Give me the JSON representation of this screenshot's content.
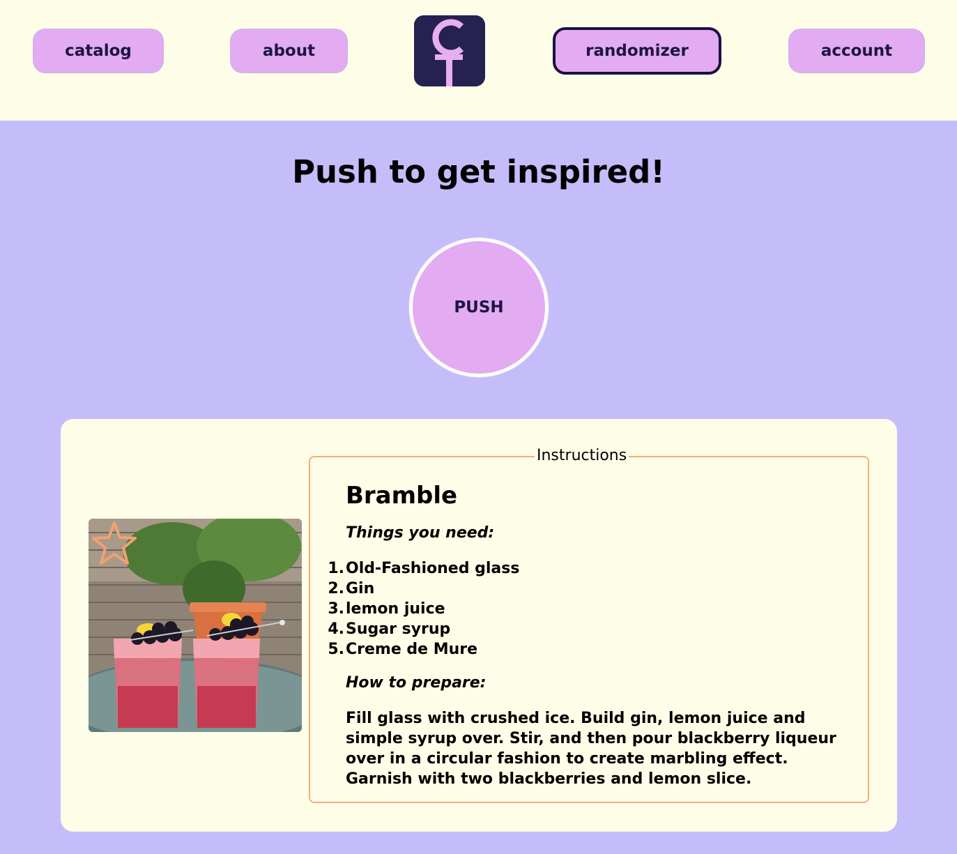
{
  "nav": {
    "catalog": "catalog",
    "about": "about",
    "randomizer": "randomizer",
    "account": "account",
    "active": "randomizer"
  },
  "logo": {
    "letters": "C",
    "colors": {
      "bg": "#252150",
      "mark": "#e7aef0"
    }
  },
  "main": {
    "title": "Push to get inspired!",
    "push_label": "PUSH"
  },
  "recipe": {
    "legend": "Instructions",
    "name": "Bramble",
    "needs_heading": "Things you need:",
    "ingredients": [
      {
        "n": "1.",
        "text": "Old-Fashioned glass"
      },
      {
        "n": "2.",
        "text": "Gin"
      },
      {
        "n": "3.",
        "text": "lemon juice"
      },
      {
        "n": "4.",
        "text": "Sugar syrup"
      },
      {
        "n": "5.",
        "text": "Creme de Mure"
      }
    ],
    "prepare_heading": "How to prepare:",
    "instructions": "Fill glass with crushed ice. Build gin, lemon juice and simple syrup over. Stir, and then pour blackberry liqueur over in a circular fashion to create marbling effect. Garnish with two blackberries and lemon slice.",
    "favorite_icon": "star-outline-icon",
    "favorited": false
  },
  "colors": {
    "page_bg": "#c4bdfa",
    "header_bg": "#fefee8",
    "button_bg": "#e2abf2",
    "active_border": "#1a1240",
    "fieldset_border": "#f3ad7a",
    "star": "#f3a070"
  }
}
